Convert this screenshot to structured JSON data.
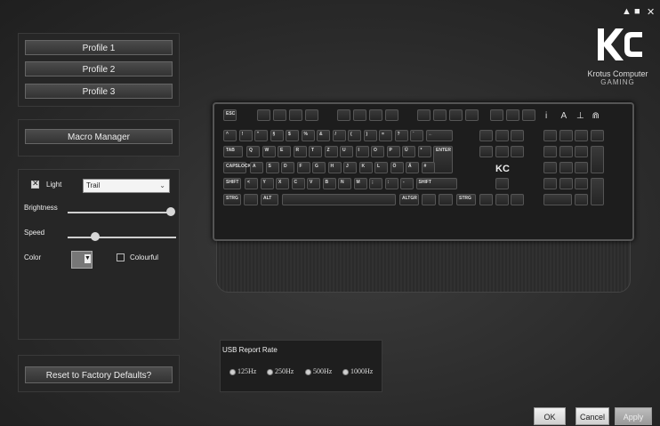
{
  "window_controls": {
    "minimize": "▲",
    "restore": "■",
    "close": "✕"
  },
  "profiles": [
    "Profile 1",
    "Profile 2",
    "Profile 3"
  ],
  "macro_manager_label": "Macro Manager",
  "light": {
    "enabled": true,
    "label": "Light",
    "effect": "Trail",
    "brightness_label": "Brightness",
    "brightness_level": 1.0,
    "speed_label": "Speed",
    "speed_level": 0.28,
    "color_label": "Color",
    "colourful_label": "Colourful",
    "colourful_checked": false
  },
  "reset_label": "Reset to Factory Defaults?",
  "brand": {
    "name": "Krotus Computer",
    "sub": "GAMING",
    "keyboard_logo": "KC"
  },
  "keyboard_legends": {
    "esc": "ESC",
    "tab": "TAB",
    "caps": "CAPSLOCK",
    "shift": "SHIFT",
    "shift_r": "SHIFT",
    "strg": "STRG",
    "alt": "ALT",
    "altgr": "ALTGR",
    "strg_r": "STRG",
    "enter": "ENTER",
    "row2": [
      "^",
      "!",
      "\"",
      "§",
      "$",
      "%",
      "&",
      "/",
      "(",
      ")",
      "=",
      "?",
      "`",
      "←"
    ],
    "row3": [
      "Q",
      "W",
      "E",
      "R",
      "T",
      "Z",
      "U",
      "I",
      "O",
      "P",
      "Ü",
      "*"
    ],
    "row4": [
      "A",
      "S",
      "D",
      "F",
      "G",
      "H",
      "J",
      "K",
      "L",
      "Ö",
      "Ä",
      "#"
    ],
    "row5": [
      "<",
      "Y",
      "X",
      "C",
      "V",
      "B",
      "N",
      "M",
      ";",
      ":",
      "-"
    ]
  },
  "usb": {
    "title": "USB Report Rate",
    "options": [
      "125Hz",
      "250Hz",
      "500Hz",
      "1000Hz"
    ]
  },
  "footer": {
    "ok": "OK",
    "cancel": "Cancel",
    "apply": "Apply"
  }
}
